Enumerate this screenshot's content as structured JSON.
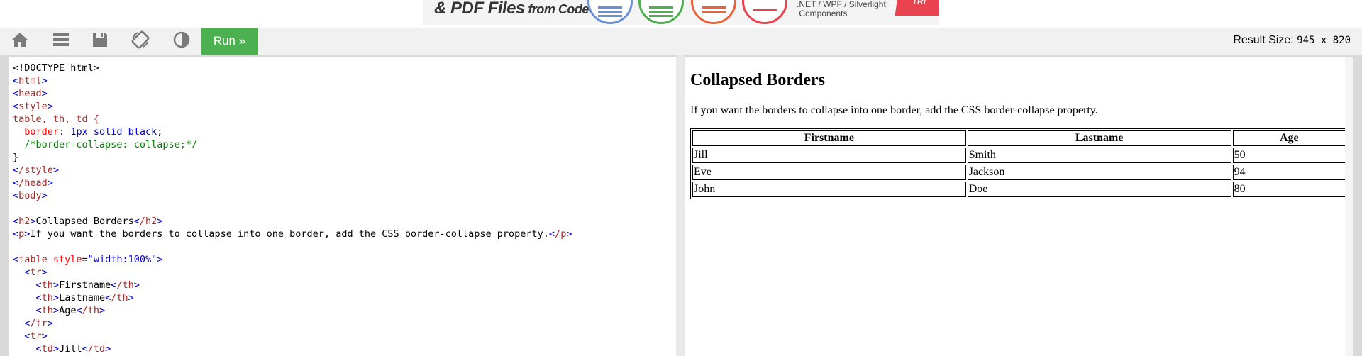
{
  "ad": {
    "headline_main": "& PDF Files",
    "headline_small": " from Code",
    "sub_line1": ".NET / WPF / Silverlight",
    "sub_line2": "Components",
    "badge": "TRI"
  },
  "toolbar": {
    "home_icon": "home-icon",
    "menu_icon": "menu-icon",
    "save_icon": "save-icon",
    "rotate_icon": "rotate-icon",
    "contrast_icon": "contrast-icon",
    "run_label": "Run »",
    "result_size_label": "Result Size:",
    "result_size_value": "945 x 820"
  },
  "colors": {
    "run_button": "#4caf50",
    "toolbar_bg": "#f1f1f1",
    "tag": "#a52a2a",
    "bracket": "#0000cd",
    "attribute": "#ff0000",
    "comment": "#008000"
  },
  "code": {
    "doctype": "<!DOCTYPE html>",
    "html": "html",
    "head": "head",
    "style": "style",
    "selector": "table, th, td {",
    "prop_border": "border",
    "val_border": "1px solid black",
    "comment": "/*border-collapse: collapse;*/",
    "close_brace": "}",
    "end_style": "/style",
    "end_head": "/head",
    "body": "body",
    "h2": "h2",
    "h2_text": "Collapsed Borders",
    "end_h2": "/h2",
    "p": "p",
    "p_text": "If you want the borders to collapse into one border, add the CSS border-collapse property.",
    "end_p": "/p",
    "table": "table",
    "table_attr": "style",
    "table_attr_val": "\"width:100%\"",
    "tr": "tr",
    "end_tr": "/tr",
    "th": "th",
    "end_th": "/th",
    "td": "td",
    "end_td": "/td",
    "th1": "Firstname",
    "th2": "Lastname",
    "th3": "Age",
    "td1": "Jill"
  },
  "result": {
    "title": "Collapsed Borders",
    "paragraph": "If you want the borders to collapse into one border, add the CSS border-collapse property.",
    "headers": [
      "Firstname",
      "Lastname",
      "Age"
    ],
    "rows": [
      [
        "Jill",
        "Smith",
        "50"
      ],
      [
        "Eve",
        "Jackson",
        "94"
      ],
      [
        "John",
        "Doe",
        "80"
      ]
    ]
  }
}
